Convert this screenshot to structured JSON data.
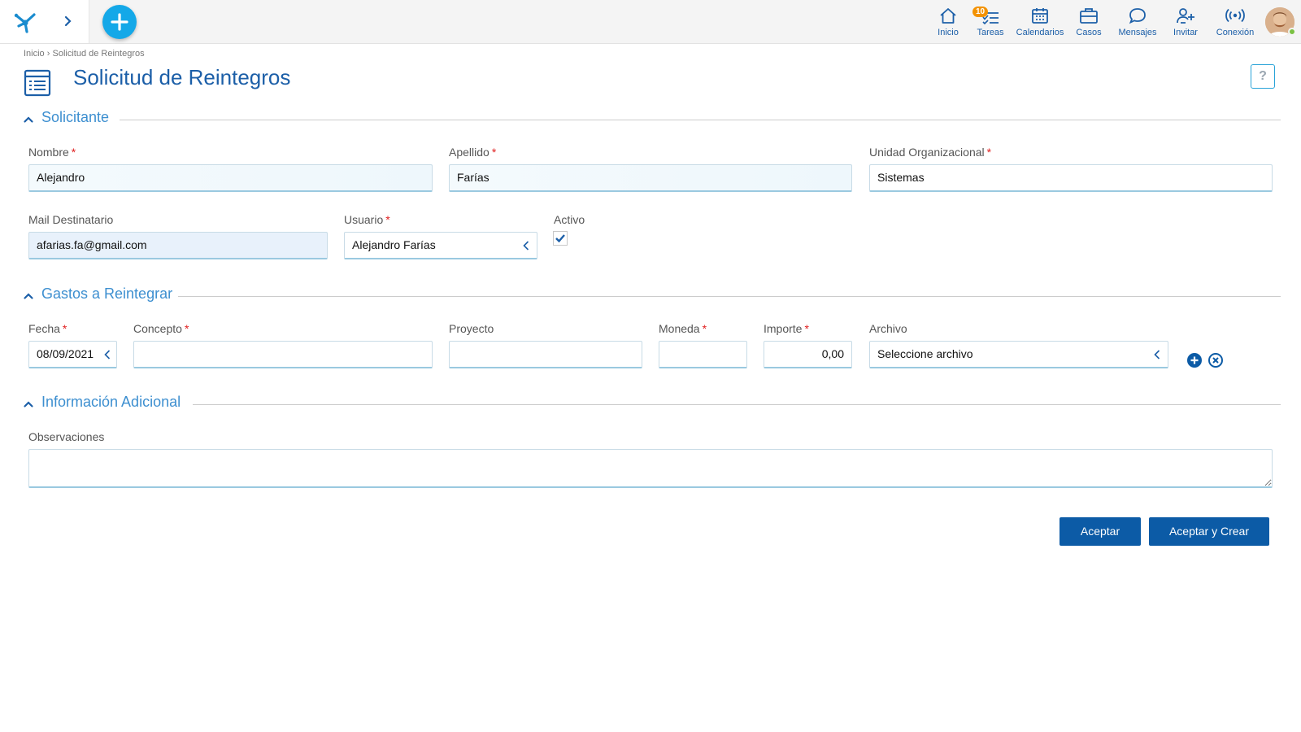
{
  "topbar": {
    "nav": [
      {
        "key": "inicio",
        "label": "Inicio",
        "icon": "home-icon"
      },
      {
        "key": "tareas",
        "label": "Tareas",
        "icon": "tasks-icon",
        "badge": "10"
      },
      {
        "key": "calendarios",
        "label": "Calendarios",
        "icon": "calendar-icon"
      },
      {
        "key": "casos",
        "label": "Casos",
        "icon": "briefcase-icon"
      },
      {
        "key": "mensajes",
        "label": "Mensajes",
        "icon": "chat-icon"
      },
      {
        "key": "invitar",
        "label": "Invitar",
        "icon": "add-user-icon"
      },
      {
        "key": "conexion",
        "label": "Conexión",
        "icon": "broadcast-icon"
      }
    ],
    "accent": "#1c5fa8",
    "fab_color": "#14a8e8",
    "badge_color": "#f39200",
    "presence_color": "#7ac142"
  },
  "breadcrumb": {
    "home": "Inicio",
    "separator": "›",
    "current": "Solicitud de Reintegros"
  },
  "page": {
    "title": "Solicitud de Reintegros",
    "help": "?"
  },
  "sections": {
    "solicitante": "Solicitante",
    "gastos": "Gastos a Reintegrar",
    "info": "Información Adicional"
  },
  "solicitante": {
    "nombre": {
      "label": "Nombre",
      "value": "Alejandro",
      "required": "*"
    },
    "apellido": {
      "label": "Apellido",
      "value": "Farías",
      "required": "*"
    },
    "unidad": {
      "label": "Unidad Organizacional",
      "value": "Sistemas",
      "required": "*"
    },
    "mail": {
      "label": "Mail Destinatario",
      "value": "afarias.fa@gmail.com"
    },
    "usuario": {
      "label": "Usuario",
      "value": "Alejandro Farías",
      "required": "*"
    },
    "activo": {
      "label": "Activo",
      "checked": true
    }
  },
  "gastos": {
    "fecha": {
      "label": "Fecha",
      "value": "08/09/2021",
      "required": "*"
    },
    "concepto": {
      "label": "Concepto",
      "value": "",
      "required": "*"
    },
    "proyecto": {
      "label": "Proyecto",
      "value": ""
    },
    "moneda": {
      "label": "Moneda",
      "value": "",
      "required": "*"
    },
    "importe": {
      "label": "Importe",
      "value": "0,00",
      "required": "*"
    },
    "archivo": {
      "label": "Archivo",
      "value": "Seleccione archivo"
    }
  },
  "info": {
    "observaciones": {
      "label": "Observaciones",
      "value": ""
    }
  },
  "actions": {
    "aceptar": "Aceptar",
    "aceptar_crear": "Aceptar y Crear",
    "button_color": "#0c5ba6"
  }
}
